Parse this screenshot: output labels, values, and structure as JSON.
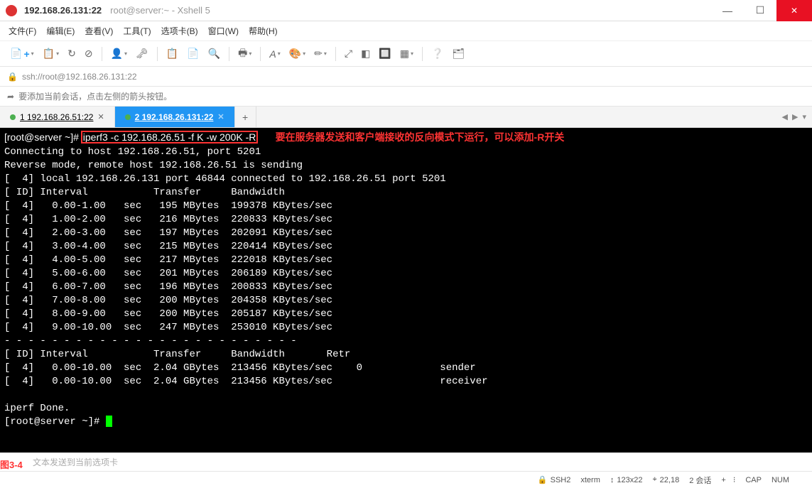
{
  "titlebar": {
    "main": "192.168.26.131:22",
    "sub": "root@server:~ - Xshell 5"
  },
  "menu": {
    "file": "文件(F)",
    "edit": "编辑(E)",
    "view": "查看(V)",
    "tools": "工具(T)",
    "tabs": "选项卡(B)",
    "window": "窗口(W)",
    "help": "帮助(H)"
  },
  "addrbar": {
    "url": "ssh://root@192.168.26.131:22"
  },
  "infobar": {
    "text": "要添加当前会话，点击左侧的箭头按钮。"
  },
  "tabs": {
    "items": [
      {
        "label": "1 192.168.26.51:22",
        "active": false
      },
      {
        "label": "2 192.168.26.131:22",
        "active": true
      }
    ]
  },
  "terminal": {
    "prompt": "[root@server ~]# ",
    "command": "iperf3 -c 192.168.26.51 -f K -w 200K -R",
    "annotation": "要在服务器发送和客户端接收的反向模式下运行，可以添加-R开关",
    "header_lines": [
      "Connecting to host 192.168.26.51, port 5201",
      "Reverse mode, remote host 192.168.26.51 is sending",
      "[  4] local 192.168.26.131 port 46844 connected to 192.168.26.51 port 5201",
      "[ ID] Interval           Transfer     Bandwidth"
    ],
    "rows": [
      {
        "id": 4,
        "interval": "0.00-1.00",
        "unit": "sec",
        "transfer": "195 MBytes",
        "bw": "199378 KBytes/sec"
      },
      {
        "id": 4,
        "interval": "1.00-2.00",
        "unit": "sec",
        "transfer": "216 MBytes",
        "bw": "220833 KBytes/sec"
      },
      {
        "id": 4,
        "interval": "2.00-3.00",
        "unit": "sec",
        "transfer": "197 MBytes",
        "bw": "202091 KBytes/sec"
      },
      {
        "id": 4,
        "interval": "3.00-4.00",
        "unit": "sec",
        "transfer": "215 MBytes",
        "bw": "220414 KBytes/sec"
      },
      {
        "id": 4,
        "interval": "4.00-5.00",
        "unit": "sec",
        "transfer": "217 MBytes",
        "bw": "222018 KBytes/sec"
      },
      {
        "id": 4,
        "interval": "5.00-6.00",
        "unit": "sec",
        "transfer": "201 MBytes",
        "bw": "206189 KBytes/sec"
      },
      {
        "id": 4,
        "interval": "6.00-7.00",
        "unit": "sec",
        "transfer": "196 MBytes",
        "bw": "200833 KBytes/sec"
      },
      {
        "id": 4,
        "interval": "7.00-8.00",
        "unit": "sec",
        "transfer": "200 MBytes",
        "bw": "204358 KBytes/sec"
      },
      {
        "id": 4,
        "interval": "8.00-9.00",
        "unit": "sec",
        "transfer": "200 MBytes",
        "bw": "205187 KBytes/sec"
      },
      {
        "id": 4,
        "interval": "9.00-10.00",
        "unit": "sec",
        "transfer": "247 MBytes",
        "bw": "253010 KBytes/sec"
      }
    ],
    "divider": "- - - - - - - - - - - - - - - - - - - - - - - - -",
    "summary_header": "[ ID] Interval           Transfer     Bandwidth       Retr",
    "summary": [
      "[  4]   0.00-10.00  sec  2.04 GBytes  213456 KBytes/sec    0             sender",
      "[  4]   0.00-10.00  sec  2.04 GBytes  213456 KBytes/sec                  receiver"
    ],
    "done": "iperf Done.",
    "prompt2": "[root@server ~]# "
  },
  "sendbar": {
    "placeholder": "文本发送到当前选项卡",
    "fig": "图3-4"
  },
  "status": {
    "ssh": "SSH2",
    "term": "xterm",
    "size": "123x22",
    "pos": "22,18",
    "sessions": "2 会话",
    "cap": "CAP",
    "num": "NUM"
  },
  "icons": {
    "lock": "🔒",
    "arrow": "➦",
    "plus": "+",
    "dd": "▾",
    "left": "◀",
    "right": "▶",
    "lock2": "🔒",
    "sizei": "↕",
    "posi": "⌖",
    "sep": "⁝"
  }
}
